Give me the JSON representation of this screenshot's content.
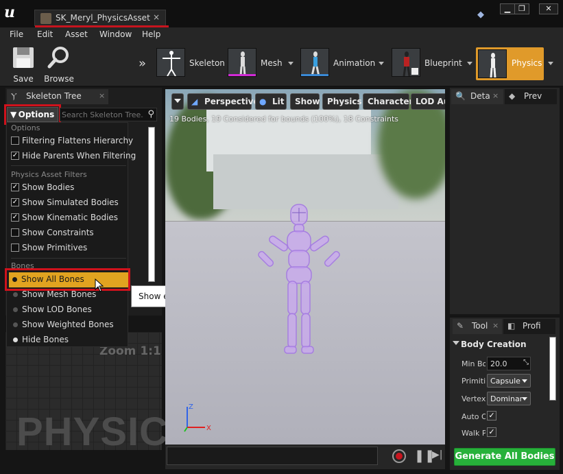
{
  "window": {
    "tab_label": "SK_Meryl_PhysicsAsset",
    "tab_close": "×",
    "controls": [
      "▁",
      "❐",
      "✕"
    ]
  },
  "menu": [
    "File",
    "Edit",
    "Asset",
    "Window",
    "Help"
  ],
  "toolbar": {
    "save_label": "Save",
    "browse_label": "Browse",
    "modes": [
      {
        "label": "Skeleton",
        "bar_color": "#2c2c2c"
      },
      {
        "label": "Mesh",
        "bar_color": "#d12ad6"
      },
      {
        "label": "Animation",
        "bar_color": "#3a8ad6"
      },
      {
        "label": "Blueprint",
        "bar_color": "#2c2c2c"
      },
      {
        "label": "Physics",
        "bar_color": "#e09a2a",
        "active": true
      }
    ]
  },
  "skeleton_tree": {
    "tab_label": "Skeleton Tree",
    "tab_close": "×",
    "options_label": "Options",
    "search_placeholder": "Search Skeleton Tree..."
  },
  "options_menu": {
    "section_options": "Options",
    "filtering_flattens": {
      "label": "Filtering Flattens Hierarchy",
      "checked": false
    },
    "hide_parents": {
      "label": "Hide Parents When Filtering",
      "checked": true
    },
    "section_filters": "Physics Asset Filters",
    "show_bodies": {
      "label": "Show Bodies",
      "checked": true
    },
    "show_simulated": {
      "label": "Show Simulated Bodies",
      "checked": true
    },
    "show_kinematic": {
      "label": "Show Kinematic Bodies",
      "checked": true
    },
    "show_constraints": {
      "label": "Show Constraints",
      "checked": false
    },
    "show_primitives": {
      "label": "Show Primitives",
      "checked": false
    },
    "section_bones": "Bones",
    "show_all_bones": "Show All Bones",
    "show_mesh_bones": "Show Mesh Bones",
    "show_lod_bones": "Show LOD Bones",
    "show_weighted_bones": "Show Weighted Bones",
    "hide_bones": "Hide Bones"
  },
  "tooltip": "Show every bone in the skeleton",
  "graph": {
    "zoom": "Zoom 1:1",
    "watermark": "PHYSIC"
  },
  "viewport": {
    "buttons": [
      "Perspective",
      "Lit",
      "Show",
      "Physics",
      "Character",
      "LOD Au"
    ],
    "stats": "19 Bodies, 19 Considered for bounds (100%), 18 Constraints",
    "axis_z": "Z",
    "axis_x": "X"
  },
  "details_tab": "Deta",
  "preview_tab": "Prev",
  "tools_tab": "Tool",
  "profile_tab": "Profi",
  "body_creation": {
    "header": "Body Creation",
    "min_bone_label": "Min Bo",
    "min_bone_value": "20.0",
    "primitive_label": "Primiti",
    "primitive_value": "Capsule",
    "vertex_label": "Vertex",
    "vertex_value": "Dominar",
    "auto_label": "Auto O",
    "walk_label": "Walk P"
  },
  "generate_button": "Generate All Bodies",
  "colors": {
    "accent_orange": "#e1a320",
    "highlight_red": "#d0121c",
    "generate_green": "#27b13a"
  }
}
